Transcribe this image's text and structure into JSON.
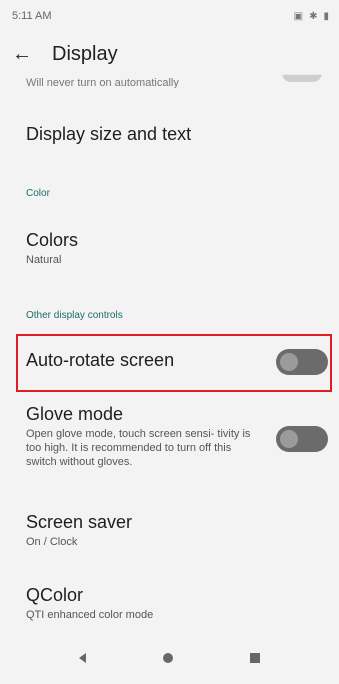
{
  "status_bar": {
    "time": "5:11 AM",
    "icons": [
      "sim-icon",
      "bluetooth-icon",
      "battery-icon"
    ]
  },
  "app_bar": {
    "title": "Display"
  },
  "clipped_item": {
    "summary": "Will never turn on automatically"
  },
  "items": {
    "display_size": {
      "title": "Display size and text"
    },
    "colors": {
      "title": "Colors",
      "summary": "Natural"
    },
    "auto_rotate": {
      "title": "Auto-rotate screen",
      "checked": false
    },
    "glove_mode": {
      "title": "Glove mode",
      "summary": "Open glove mode, touch screen sensi- tivity is too high. It is recommended to turn off this switch without gloves.",
      "checked": false
    },
    "screen_saver": {
      "title": "Screen saver",
      "summary": "On / Clock"
    },
    "qcolor": {
      "title": "QColor",
      "summary": "QTI enhanced color mode"
    }
  },
  "sections": {
    "color": "Color",
    "other": "Other display controls"
  },
  "colors": {
    "accent": "#1b6e6a",
    "highlight": "#e11b22"
  }
}
